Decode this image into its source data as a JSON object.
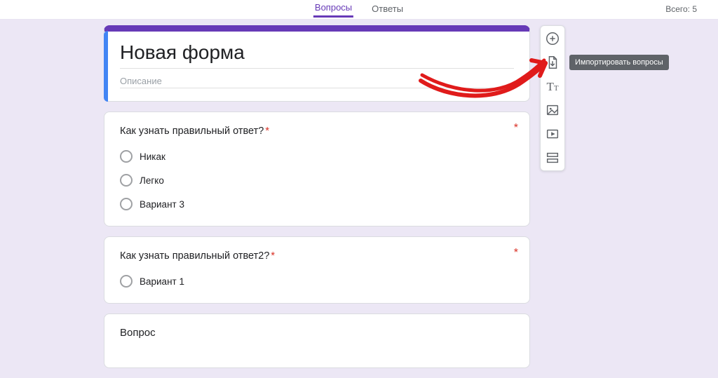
{
  "tabs": {
    "questions": "Вопросы",
    "answers": "Ответы"
  },
  "top": {
    "total_label": "Всего: 5"
  },
  "form": {
    "title": "Новая форма",
    "description_placeholder": "Описание"
  },
  "questions": [
    {
      "text": "Как узнать правильный ответ?",
      "required": true,
      "options": [
        "Никак",
        "Легко",
        "Вариант 3"
      ]
    },
    {
      "text": "Как узнать правильный ответ2?",
      "required": true,
      "options": [
        "Вариант 1"
      ]
    },
    {
      "text": "Вопрос",
      "required": false,
      "options": []
    }
  ],
  "toolbar": {
    "add_question": "Добавить вопрос",
    "import_questions": "Импортировать вопросы",
    "add_title": "Добавить название и описание",
    "add_image": "Добавить изображение",
    "add_video": "Добавить видео",
    "add_section": "Добавить раздел"
  },
  "tooltip": "Импортировать вопросы"
}
